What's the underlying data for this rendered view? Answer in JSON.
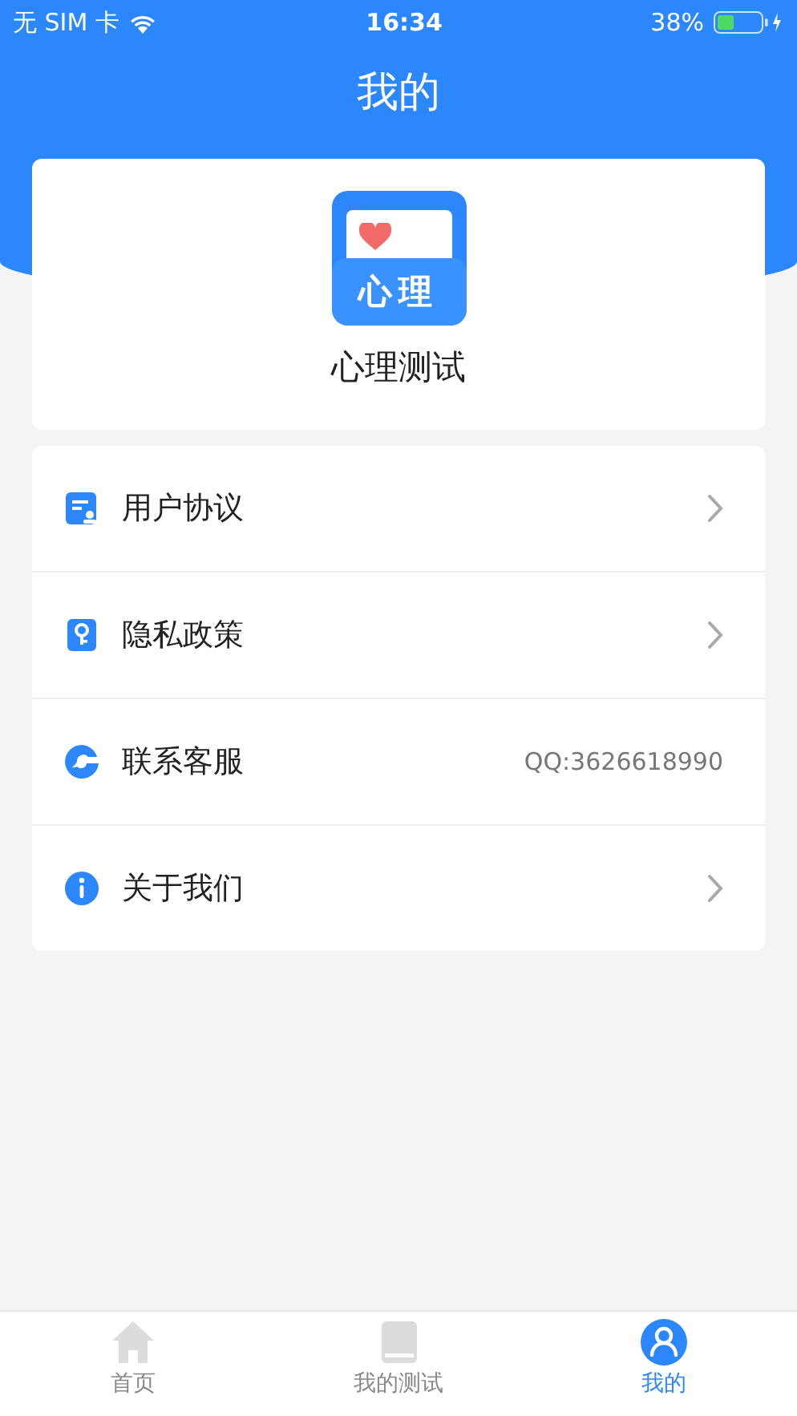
{
  "status_bar": {
    "carrier": "无 SIM 卡",
    "time": "16:34",
    "battery": "38%"
  },
  "header": {
    "title": "我的"
  },
  "app_card": {
    "logo_text": "心理",
    "name": "心理测试"
  },
  "menu": [
    {
      "kind": "link",
      "label": "用户协议"
    },
    {
      "kind": "link",
      "label": "隐私政策"
    },
    {
      "kind": "contact",
      "label": "联系客服",
      "value": "QQ:3626618990"
    },
    {
      "kind": "link",
      "label": "关于我们"
    }
  ],
  "tab_bar": [
    {
      "label": "首页",
      "selected": false
    },
    {
      "label": "我的测试",
      "selected": false
    },
    {
      "label": "我的",
      "selected": true
    }
  ]
}
